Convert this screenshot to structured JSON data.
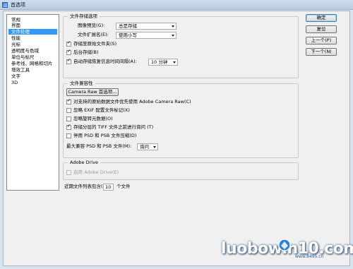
{
  "window": {
    "title": "首选项"
  },
  "sidebar": {
    "items": [
      {
        "label": "常规",
        "selected": false
      },
      {
        "label": "界面",
        "selected": false
      },
      {
        "label": "文件处理",
        "selected": true
      },
      {
        "label": "性能",
        "selected": false
      },
      {
        "label": "光标",
        "selected": false
      },
      {
        "label": "透明度与色域",
        "selected": false
      },
      {
        "label": "单位与标尺",
        "selected": false
      },
      {
        "label": "参考线、网格和切片",
        "selected": false
      },
      {
        "label": "增效工具",
        "selected": false
      },
      {
        "label": "文字",
        "selected": false
      },
      {
        "label": "3D",
        "selected": false
      }
    ]
  },
  "file_save": {
    "group_title": "文件存储选项",
    "image_preview_label": "图像预览(G):",
    "image_preview_value": "总是存储",
    "file_ext_label": "文件扩展名(E):",
    "file_ext_value": "使用小写",
    "save_in_original_folder": {
      "label": "存储至原始文件夹(S)",
      "checked": true
    },
    "background_save": {
      "label": "后台存储(B)",
      "checked": true
    },
    "auto_save": {
      "label": "自动存储恢复信息时间间隔(A):",
      "checked": true
    },
    "auto_save_interval": "10 分钟"
  },
  "compat": {
    "group_title": "文件兼容性",
    "camera_raw_button": "Camera Raw 首选项...",
    "prefer_acr": {
      "label": "对支持的原始数据文件优先使用 Adobe Camera Raw(C)",
      "checked": true
    },
    "ignore_exif": {
      "label": "忽略 EXIF 配置文件标记(X)",
      "checked": false
    },
    "ignore_rotation": {
      "label": "忽略旋转元数据(O)",
      "checked": false
    },
    "ask_tiff": {
      "label": "存储分层的 TIFF 文件之前进行询问 (T)",
      "checked": true
    },
    "disable_compression": {
      "label": "停用 PSD 和 PSB 文件压缩(D)",
      "checked": false
    },
    "max_compat_label": "最大兼容 PSD 和 PSB 文件(M):",
    "max_compat_value": "询问"
  },
  "drive": {
    "group_title": "Adobe Drive",
    "enable": {
      "label": "启用 Adobe Drive(E)",
      "checked": false
    }
  },
  "recent": {
    "label": "近期文件列表包含(R):",
    "value": "10",
    "suffix": "个文件"
  },
  "buttons": {
    "ok": "确定",
    "reset": "复位",
    "prev": "上一个(P)",
    "next": "下一个(N)"
  },
  "watermark": {
    "text": "luobowin10.com",
    "sub": "www.8495.cn"
  }
}
